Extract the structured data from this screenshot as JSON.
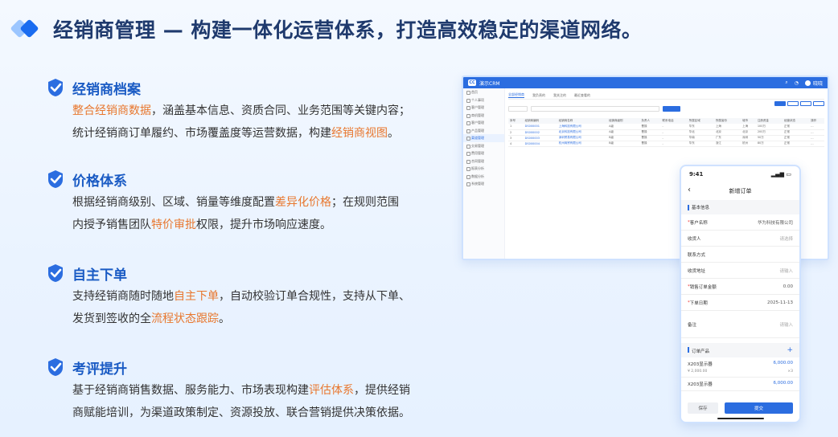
{
  "page": {
    "title": "经销商管理 — 构建一体化运营体系，打造高效稳定的渠道网络。"
  },
  "sections": [
    {
      "title": "经销商档案",
      "lines": [
        [
          {
            "t": "整合经销商数据",
            "h": true
          },
          {
            "t": "，涵盖基本信息、资质合同、业务范围等关键内容；",
            "h": false
          }
        ],
        [
          {
            "t": "统计经销商订单履约、市场覆盖度等运营数据，构建",
            "h": false
          },
          {
            "t": "经销商视图",
            "h": true
          },
          {
            "t": "。",
            "h": false
          }
        ]
      ]
    },
    {
      "title": "价格体系",
      "lines": [
        [
          {
            "t": "根据经销商级别、区域、销量等维度配置",
            "h": false
          },
          {
            "t": "差异化价格",
            "h": true
          },
          {
            "t": "；在规则范围",
            "h": false
          }
        ],
        [
          {
            "t": "内授予销售团队",
            "h": false
          },
          {
            "t": "特价审批",
            "h": true
          },
          {
            "t": "权限，提升市场响应速度。",
            "h": false
          }
        ]
      ]
    },
    {
      "title": "自主下单",
      "lines": [
        [
          {
            "t": "支持经销商随时随地",
            "h": false
          },
          {
            "t": "自主下单",
            "h": true
          },
          {
            "t": "，自动校验订单合规性，支持从下单、",
            "h": false
          }
        ],
        [
          {
            "t": "发货到签收的全",
            "h": false
          },
          {
            "t": "流程状态跟踪",
            "h": true
          },
          {
            "t": "。",
            "h": false
          }
        ]
      ]
    },
    {
      "title": "考评提升",
      "lines": [
        [
          {
            "t": "基于经销商销售数据、服务能力、市场表现构建",
            "h": false
          },
          {
            "t": "评估体系",
            "h": true
          },
          {
            "t": "，提供经销",
            "h": false
          }
        ],
        [
          {
            "t": "商赋能培训，为渠道政策制定、资源投放、联合营销提供决策依据。",
            "h": false
          }
        ]
      ]
    }
  ],
  "crm": {
    "app_name": "演示CRM",
    "logo_text": "CC",
    "user": "晓晓",
    "sidebar": [
      "首页",
      "个人事项",
      "客户管理",
      "商机管理",
      "客户管理",
      "产品管理",
      "渠道管理",
      "交易管理",
      "费用管理",
      "合同管理",
      "报表分析",
      "数据分析",
      "系统管理"
    ],
    "tabs": [
      "全部经销商",
      "我负责的",
      "我关注的",
      "最近查看的"
    ],
    "table_headers": [
      "序号",
      "经销商编码",
      "经销商名称",
      "经销商级别",
      "负责人",
      "联系电话",
      "所属区域",
      "所属省份",
      "城市",
      "注册资金",
      "经营状态",
      "操作"
    ],
    "rows": [
      [
        "1",
        "DS000001",
        "上海科技有限公司",
        "A级",
        "曹操",
        "-",
        "华东",
        "上海",
        "上海",
        "100万",
        "正常",
        "..."
      ],
      [
        "2",
        "DS000002",
        "北京科技有限公司",
        "A级",
        "曹操",
        "-",
        "华北",
        "北京",
        "北京",
        "200万",
        "正常",
        "..."
      ],
      [
        "3",
        "DS000003",
        "深圳贸易有限公司",
        "B级",
        "曹操",
        "-",
        "华南",
        "广东",
        "深圳",
        "50万",
        "正常",
        "..."
      ],
      [
        "4",
        "DS000004",
        "杭州商贸有限公司",
        "B级",
        "曹操",
        "-",
        "华东",
        "浙江",
        "杭州",
        "80万",
        "正常",
        "..."
      ]
    ]
  },
  "phone": {
    "time": "9:41",
    "nav_title": "新增订单",
    "basic_section": "基本信息",
    "fields": [
      {
        "label": "客户名称",
        "value": "华为科技有限公司",
        "placeholder": false,
        "required": true
      },
      {
        "label": "收货人",
        "value": "请选择",
        "placeholder": true,
        "required": false
      },
      {
        "label": "联系方式",
        "value": "",
        "placeholder": true,
        "required": false
      },
      {
        "label": "收货地址",
        "value": "请输入",
        "placeholder": true,
        "required": false
      },
      {
        "label": "销售订单金额",
        "value": "0.00",
        "placeholder": false,
        "required": true
      },
      {
        "label": "下单日期",
        "value": "2025-11-13",
        "placeholder": false,
        "required": true
      },
      {
        "label": "备注",
        "value": "请输入",
        "placeholder": true,
        "required": false
      }
    ],
    "products_section": "订单产品",
    "products": [
      {
        "name": "X203显示器",
        "price": "6,000.00",
        "unit": "¥ 2,000.00",
        "qty": "×3"
      },
      {
        "name": "X203显示器",
        "price": "6,000.00",
        "unit": "",
        "qty": ""
      }
    ],
    "save_label": "保存",
    "submit_label": "提交"
  }
}
